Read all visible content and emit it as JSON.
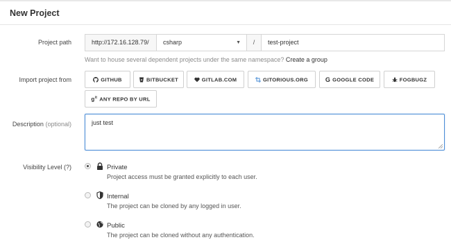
{
  "page": {
    "title": "New Project"
  },
  "project_path": {
    "label": "Project path",
    "url_prefix": "http://172.16.128.79/",
    "namespace": "csharp",
    "separator": "/",
    "project_name": "test-project",
    "help_text": "Want to house several dependent projects under the same namespace?",
    "help_link": "Create a group"
  },
  "import": {
    "label": "Import project from",
    "buttons": [
      {
        "label": "GITHUB",
        "icon": "github-icon"
      },
      {
        "label": "BITBUCKET",
        "icon": "bitbucket-icon"
      },
      {
        "label": "GITLAB.COM",
        "icon": "heart-icon"
      },
      {
        "label": "GITORIOUS.ORG",
        "icon": "crop-icon"
      },
      {
        "label": "GOOGLE CODE",
        "icon": "google-icon"
      },
      {
        "label": "FOGBUGZ",
        "icon": "bug-icon"
      },
      {
        "label": "ANY REPO BY URL",
        "icon": "git-icon"
      }
    ]
  },
  "description": {
    "label": "Description",
    "optional": "(optional)",
    "value": "just test"
  },
  "visibility": {
    "label": "Visibility Level (?)",
    "options": [
      {
        "title": "Private",
        "desc": "Project access must be granted explicitly to each user.",
        "icon": "lock-icon",
        "selected": true
      },
      {
        "title": "Internal",
        "desc": "The project can be cloned by any logged in user.",
        "icon": "shield-icon",
        "selected": false
      },
      {
        "title": "Public",
        "desc": "The project can be cloned without any authentication.",
        "icon": "globe-icon",
        "selected": false
      }
    ]
  },
  "colors": {
    "focus_border": "#4a8cd6",
    "link": "#333333",
    "muted": "#8c8c8c"
  }
}
